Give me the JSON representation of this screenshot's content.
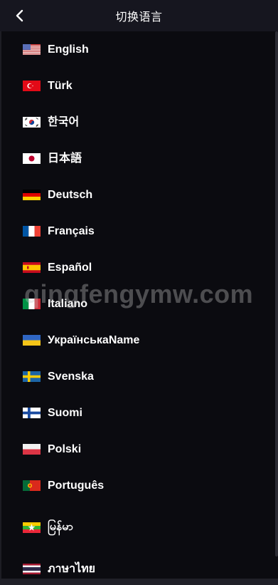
{
  "header": {
    "title": "切换语言"
  },
  "languages": [
    {
      "label": "English",
      "flag": "us-flag-icon"
    },
    {
      "label": "Türk",
      "flag": "turkey-flag-icon"
    },
    {
      "label": "한국어",
      "flag": "korea-flag-icon"
    },
    {
      "label": "日本語",
      "flag": "japan-flag-icon"
    },
    {
      "label": "Deutsch",
      "flag": "germany-flag-icon"
    },
    {
      "label": "Français",
      "flag": "france-flag-icon"
    },
    {
      "label": "Español",
      "flag": "spain-flag-icon"
    },
    {
      "label": "Italiano",
      "flag": "italy-flag-icon"
    },
    {
      "label": "УкраїнськаName",
      "flag": "ukraine-flag-icon"
    },
    {
      "label": "Svenska",
      "flag": "sweden-flag-icon"
    },
    {
      "label": "Suomi",
      "flag": "finland-flag-icon"
    },
    {
      "label": "Polski",
      "flag": "poland-flag-icon"
    },
    {
      "label": "Português",
      "flag": "portugal-flag-icon"
    },
    {
      "label": "မြန်မာ",
      "flag": "myanmar-flag-icon"
    },
    {
      "label": "ภาษาไทย",
      "flag": "thailand-flag-icon"
    }
  ],
  "watermark": "qingfengymw.com",
  "colors": {
    "background": "#0b0b10",
    "header": "#16161f",
    "text": "#ffffff"
  }
}
